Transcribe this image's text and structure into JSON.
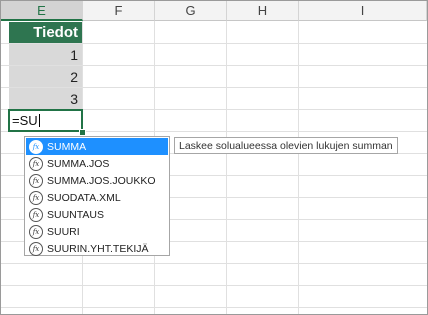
{
  "columns": [
    {
      "letter": "E",
      "active": true
    },
    {
      "letter": "F",
      "active": false
    },
    {
      "letter": "G",
      "active": false
    },
    {
      "letter": "H",
      "active": false
    },
    {
      "letter": "I",
      "active": false
    }
  ],
  "table": {
    "header": "Tiedot",
    "values": [
      "1",
      "2",
      "3"
    ]
  },
  "edit_cell": {
    "text": "=SU"
  },
  "autocomplete": {
    "items": [
      {
        "label": "SUMMA",
        "icon": "function-icon",
        "selected": true
      },
      {
        "label": "SUMMA.JOS",
        "icon": "function-icon",
        "selected": false
      },
      {
        "label": "SUMMA.JOS.JOUKKO",
        "icon": "function-icon",
        "selected": false
      },
      {
        "label": "SUODATA.XML",
        "icon": "function-icon",
        "selected": false
      },
      {
        "label": "SUUNTAUS",
        "icon": "function-icon",
        "selected": false
      },
      {
        "label": "SUURI",
        "icon": "function-icon",
        "selected": false
      },
      {
        "label": "SUURIN.YHT.TEKIJÄ",
        "icon": "function-icon",
        "selected": false
      }
    ],
    "icon_glyph": "fx",
    "tooltip": "Laskee solualueessa olevien lukujen summan"
  },
  "colors": {
    "accent": "#217346",
    "header_fill": "#2e7550",
    "selection": "#1e90ff"
  }
}
